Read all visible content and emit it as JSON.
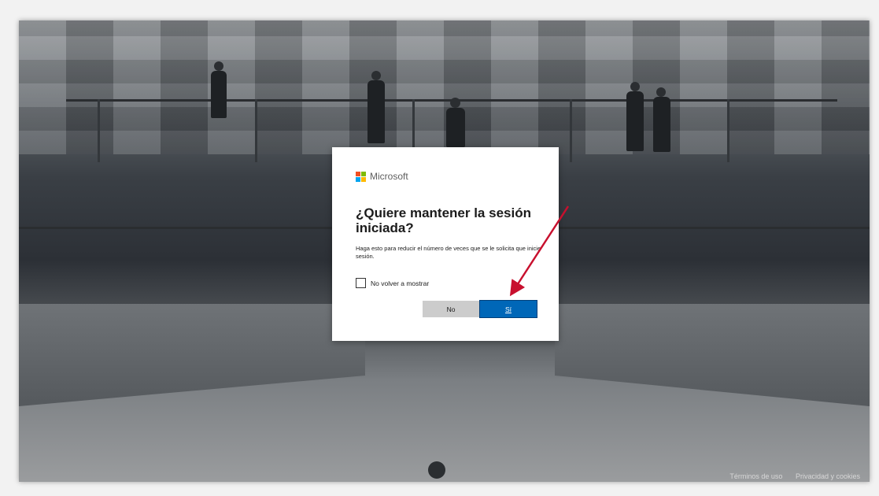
{
  "dialog": {
    "brand": "Microsoft",
    "title": "¿Quiere mantener la sesión iniciada?",
    "description": "Haga esto para reducir el número de veces que se le solicita que inicie sesión.",
    "checkbox_label": "No volver a mostrar",
    "checkbox_checked": false,
    "no_button": "No",
    "yes_button": "Sí"
  },
  "footer": {
    "terms": "Términos de uso",
    "privacy": "Privacidad y cookies"
  },
  "colors": {
    "primary_button": "#0067b8",
    "secondary_button": "#cccccc",
    "annotation_arrow": "#c8102e",
    "logo_red": "#f25022",
    "logo_green": "#7fba00",
    "logo_blue": "#00a4ef",
    "logo_yellow": "#ffb900"
  },
  "icons": [
    "microsoft-logo-icon",
    "checkbox-icon",
    "annotation-arrow-icon"
  ]
}
